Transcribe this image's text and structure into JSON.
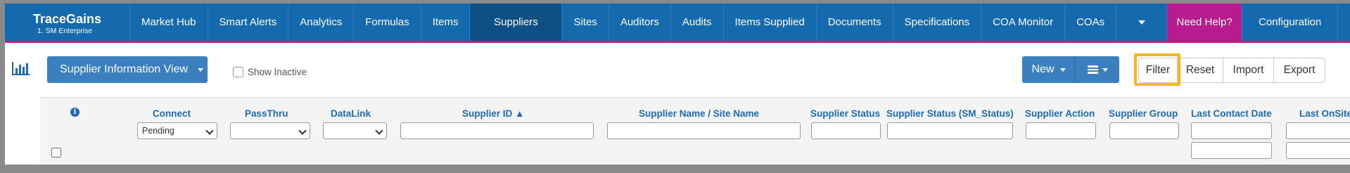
{
  "brand": {
    "name": "TraceGains",
    "subtitle": "1. SM Enterprise"
  },
  "nav": {
    "items": [
      "Market Hub",
      "Smart Alerts",
      "Analytics",
      "Formulas",
      "Items",
      "Suppliers",
      "Sites",
      "Auditors",
      "Audits",
      "Items Supplied",
      "Documents",
      "Specifications",
      "COA Monitor",
      "COAs"
    ],
    "active": "Suppliers",
    "help_label": "Need Help?",
    "config_label": "Configuration",
    "more_icon": "caret-down-icon",
    "user_icon": "user-icon"
  },
  "toolbar": {
    "view_label": "Supplier Information View",
    "show_inactive_label": "Show Inactive",
    "new_label": "New",
    "filter_label": "Filter",
    "reset_label": "Reset",
    "import_label": "Import",
    "export_label": "Export"
  },
  "grid": {
    "columns": [
      "Connect",
      "PassThru",
      "DataLink",
      "Supplier ID ▲",
      "Supplier Name / Site Name",
      "Supplier Status",
      "Supplier Status (SM_Status)",
      "Supplier Action",
      "Supplier Group",
      "Last Contact Date",
      "Last OnSite"
    ],
    "connect_filter_value": "Pending",
    "info_icon": "info-icon"
  },
  "colors": {
    "nav_bg": "#1569ad",
    "nav_active": "#0e4f86",
    "help_bg": "#b81a8f",
    "accent_line": "#c21c7e",
    "highlight": "#f5b91c",
    "header_text": "#1e6ab2"
  }
}
